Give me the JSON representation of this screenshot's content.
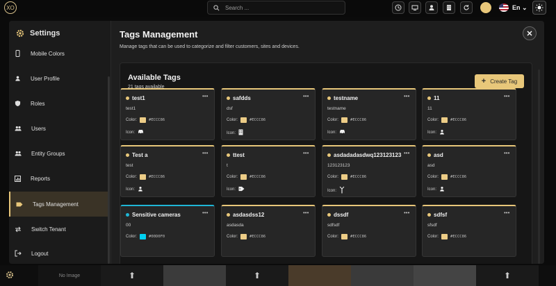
{
  "topbar": {
    "search_placeholder": "Search ...",
    "language": "En",
    "logo_text": "XO"
  },
  "settings": {
    "title": "Settings",
    "items": [
      {
        "label": "Mobile Colors",
        "icon": "mobile-icon"
      },
      {
        "label": "User Profile",
        "icon": "user-icon"
      },
      {
        "label": "Roles",
        "icon": "shield-icon"
      },
      {
        "label": "Users",
        "icon": "users-icon"
      },
      {
        "label": "Entity Groups",
        "icon": "groups-icon"
      },
      {
        "label": "Reports",
        "icon": "chart-icon"
      },
      {
        "label": "Tags Management",
        "icon": "tag-icon",
        "active": true
      },
      {
        "label": "Switch Tenant",
        "icon": "switch-icon"
      },
      {
        "label": "Logout",
        "icon": "logout-icon"
      }
    ]
  },
  "main": {
    "title": "Tags Management",
    "description": "Manage tags that can be used to categorize and filter customers, sites and devices."
  },
  "panel": {
    "title": "Available Tags",
    "count_text": "21 tags available",
    "create_label": "Create Tag"
  },
  "tags": [
    {
      "name": "test1",
      "description": "test1",
      "color_label": "Color:",
      "color": "#ECCC86",
      "icon_label": "Icon:",
      "icon": "car-icon"
    },
    {
      "name": "safdds",
      "description": "dsf",
      "color_label": "Color:",
      "color": "#ECCC86",
      "icon_label": "Icon:",
      "icon": "building-icon"
    },
    {
      "name": "testname",
      "description": "testname",
      "color_label": "Color:",
      "color": "#ECCC86",
      "icon_label": "Icon:",
      "icon": "car-icon"
    },
    {
      "name": "11",
      "description": "11",
      "color_label": "Color:",
      "color": "#ECCC86",
      "icon_label": "Icon:",
      "icon": "person-icon"
    },
    {
      "name": "Test a",
      "description": "test",
      "color_label": "Color:",
      "color": "#ECCC86",
      "icon_label": "Icon:",
      "icon": "person-icon"
    },
    {
      "name": "ttest",
      "description": "t",
      "color_label": "Color:",
      "color": "#ECCC86",
      "icon_label": "Icon:",
      "icon": "tag-icon"
    },
    {
      "name": "asdadadasdwq123123123",
      "description": "123123123",
      "color_label": "Color:",
      "color": "#ECCC86",
      "icon_label": "Icon:",
      "icon": "antenna-icon"
    },
    {
      "name": "asd",
      "description": "asd",
      "color_label": "Color:",
      "color": "#ECCC86",
      "icon_label": "Icon:",
      "icon": "person-icon"
    },
    {
      "name": "Sensitive cameras",
      "description": "00",
      "color_label": "Color:",
      "color": "#00D0F0",
      "icon_label": "",
      "icon": ""
    },
    {
      "name": "asdasdss12",
      "description": "asdasda",
      "color_label": "Color:",
      "color": "#ECCC86",
      "icon_label": "",
      "icon": ""
    },
    {
      "name": "dssdf",
      "description": "sdfsdf",
      "color_label": "Color:",
      "color": "#ECCC86",
      "icon_label": "",
      "icon": ""
    },
    {
      "name": "sdfsf",
      "description": "sfsdf",
      "color_label": "Color:",
      "color": "#ECCC86",
      "icon_label": "",
      "icon": ""
    }
  ],
  "bottom": {
    "no_image": "No Image"
  }
}
